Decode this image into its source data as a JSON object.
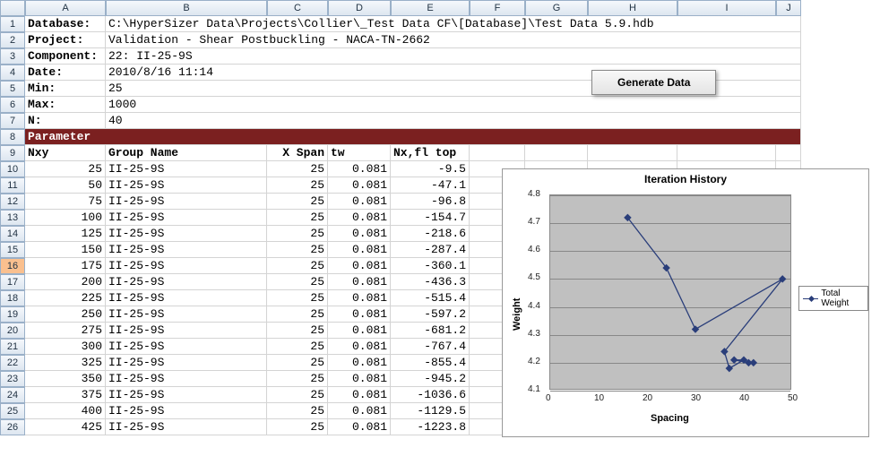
{
  "headers": {
    "cols": [
      "A",
      "B",
      "C",
      "D",
      "E",
      "F",
      "G",
      "H",
      "I",
      "J"
    ],
    "rows": [
      "1",
      "2",
      "3",
      "4",
      "5",
      "6",
      "7",
      "8",
      "9",
      "10",
      "11",
      "12",
      "13",
      "14",
      "15",
      "16",
      "17",
      "18",
      "19",
      "20",
      "21",
      "22",
      "23",
      "24",
      "25",
      "26"
    ],
    "selected_row": "16"
  },
  "meta": {
    "database_label": "Database:",
    "database_value": "C:\\HyperSizer Data\\Projects\\Collier\\_Test Data CF\\[Database]\\Test Data 5.9.hdb",
    "project_label": "Project:",
    "project_value": "Validation - Shear Postbuckling - NACA-TN-2662",
    "component_label": "Component:",
    "component_value": "22: II-25-9S",
    "date_label": "Date:",
    "date_value": "2010/8/16 11:14",
    "min_label": "Min:",
    "min_value": "25",
    "max_label": "Max:",
    "max_value": "1000",
    "n_label": "N:",
    "n_value": "40",
    "parameter_label": "Parameter",
    "col_nxy": "Nxy",
    "col_group": "Group Name",
    "col_xspan": "X Span",
    "col_tw": "tw",
    "col_nxfl": "Nx,fl top"
  },
  "rows": [
    {
      "nxy": "25",
      "group": "II-25-9S",
      "xspan": "25",
      "tw": "0.081",
      "nxfl": "-9.5"
    },
    {
      "nxy": "50",
      "group": "II-25-9S",
      "xspan": "25",
      "tw": "0.081",
      "nxfl": "-47.1"
    },
    {
      "nxy": "75",
      "group": "II-25-9S",
      "xspan": "25",
      "tw": "0.081",
      "nxfl": "-96.8"
    },
    {
      "nxy": "100",
      "group": "II-25-9S",
      "xspan": "25",
      "tw": "0.081",
      "nxfl": "-154.7"
    },
    {
      "nxy": "125",
      "group": "II-25-9S",
      "xspan": "25",
      "tw": "0.081",
      "nxfl": "-218.6"
    },
    {
      "nxy": "150",
      "group": "II-25-9S",
      "xspan": "25",
      "tw": "0.081",
      "nxfl": "-287.4"
    },
    {
      "nxy": "175",
      "group": "II-25-9S",
      "xspan": "25",
      "tw": "0.081",
      "nxfl": "-360.1"
    },
    {
      "nxy": "200",
      "group": "II-25-9S",
      "xspan": "25",
      "tw": "0.081",
      "nxfl": "-436.3"
    },
    {
      "nxy": "225",
      "group": "II-25-9S",
      "xspan": "25",
      "tw": "0.081",
      "nxfl": "-515.4"
    },
    {
      "nxy": "250",
      "group": "II-25-9S",
      "xspan": "25",
      "tw": "0.081",
      "nxfl": "-597.2"
    },
    {
      "nxy": "275",
      "group": "II-25-9S",
      "xspan": "25",
      "tw": "0.081",
      "nxfl": "-681.2"
    },
    {
      "nxy": "300",
      "group": "II-25-9S",
      "xspan": "25",
      "tw": "0.081",
      "nxfl": "-767.4"
    },
    {
      "nxy": "325",
      "group": "II-25-9S",
      "xspan": "25",
      "tw": "0.081",
      "nxfl": "-855.4"
    },
    {
      "nxy": "350",
      "group": "II-25-9S",
      "xspan": "25",
      "tw": "0.081",
      "nxfl": "-945.2"
    },
    {
      "nxy": "375",
      "group": "II-25-9S",
      "xspan": "25",
      "tw": "0.081",
      "nxfl": "-1036.6"
    },
    {
      "nxy": "400",
      "group": "II-25-9S",
      "xspan": "25",
      "tw": "0.081",
      "nxfl": "-1129.5"
    },
    {
      "nxy": "425",
      "group": "II-25-9S",
      "xspan": "25",
      "tw": "0.081",
      "nxfl": "-1223.8"
    }
  ],
  "button": {
    "label": "Generate Data"
  },
  "chart_data": {
    "type": "line",
    "title": "Iteration History",
    "xlabel": "Spacing",
    "ylabel": "Weight",
    "xlim": [
      0,
      50
    ],
    "ylim": [
      4.1,
      4.8
    ],
    "xticks": [
      0,
      10,
      20,
      30,
      40,
      50
    ],
    "yticks": [
      4.1,
      4.2,
      4.3,
      4.4,
      4.5,
      4.6,
      4.7,
      4.8
    ],
    "series": [
      {
        "name": "Total Weight",
        "points": [
          {
            "x": 16,
            "y": 4.72
          },
          {
            "x": 24,
            "y": 4.54
          },
          {
            "x": 30,
            "y": 4.32
          },
          {
            "x": 48,
            "y": 4.5
          },
          {
            "x": 36,
            "y": 4.24
          },
          {
            "x": 37,
            "y": 4.18
          },
          {
            "x": 40,
            "y": 4.21
          },
          {
            "x": 38,
            "y": 4.21
          },
          {
            "x": 41,
            "y": 4.2
          },
          {
            "x": 42,
            "y": 4.2
          }
        ]
      }
    ]
  }
}
